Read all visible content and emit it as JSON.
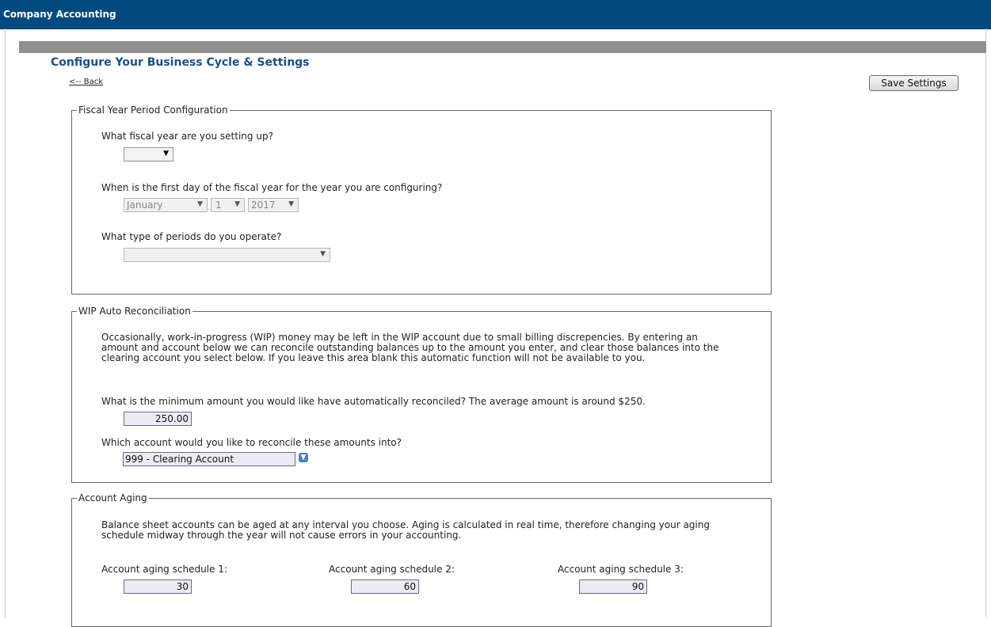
{
  "app": {
    "title": "Company Accounting"
  },
  "header": {
    "page_title": "Configure Your Business Cycle & Settings",
    "back_label": "<-- Back",
    "save_label": "Save Settings"
  },
  "fiscal": {
    "legend": "Fiscal Year Period Configuration",
    "q_year": "What fiscal year are you setting up?",
    "year_value": "",
    "q_first_day": "When is the first day of the fiscal year for the year you are configuring?",
    "month": "January",
    "day": "1",
    "year": "2017",
    "q_periods": "What type of periods do you operate?",
    "periods_value": ""
  },
  "wip": {
    "legend": "WIP Auto Reconciliation",
    "description": "Occasionally, work-in-progress (WIP) money may be left in the WIP account due to small billing discrepencies. By entering an amount and account below we can reconcile outstanding balances up to the amount you enter, and clear those balances into the clearing account you select below. If you leave this area blank this automatic function will not be available to you.",
    "q_min_amount": "What is the minimum amount you would like have automatically reconciled? The average amount is around $250.",
    "min_amount": "250.00",
    "q_account": "Which account would you like to reconcile these amounts into?",
    "account": "999 - Clearing Account"
  },
  "aging": {
    "legend": "Account Aging",
    "description": "Balance sheet accounts can be aged at any interval you choose. Aging is calculated in real time, therefore changing your aging schedule midway through the year will not cause errors in your accounting.",
    "schedules": [
      {
        "label": "Account aging schedule 1:",
        "value": "30"
      },
      {
        "label": "Account aging schedule 2:",
        "value": "60"
      },
      {
        "label": "Account aging schedule 3:",
        "value": "90"
      }
    ]
  },
  "icons": {
    "dropdown": "chevron-down-icon"
  },
  "colors": {
    "titlebar": "#004a80",
    "heading": "#1c4f86",
    "input_bg": "#ecebf4"
  }
}
